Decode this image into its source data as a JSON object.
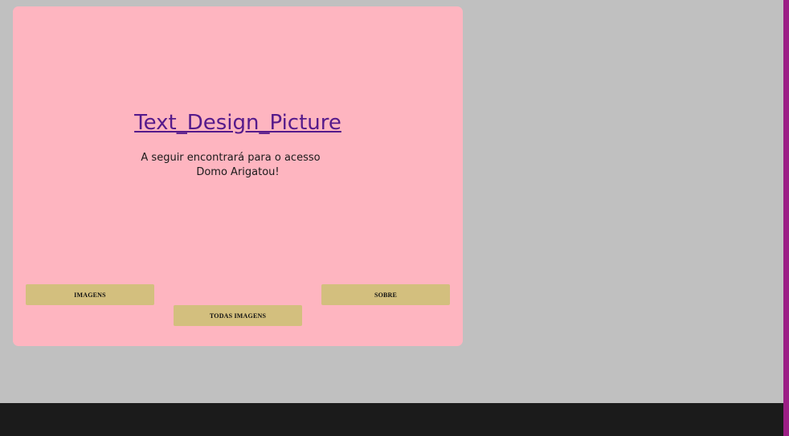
{
  "card": {
    "title": "Text_Design_Picture",
    "subtitle_line1": "A seguir encontrará para o acesso",
    "subtitle_line2": "Domo Arigatou!"
  },
  "nav": {
    "imagens": "IMAGENS",
    "sobre": "SOBRE",
    "todas_imagens": "TODAS IMAGENS"
  },
  "colors": {
    "page_background": "#c0c0c0",
    "card_background": "#feb5c0",
    "title_link": "#551a8b",
    "button_background": "#d3bf7e",
    "right_strip": "#9b1f85",
    "bottom_bar": "#1b1b1b"
  }
}
